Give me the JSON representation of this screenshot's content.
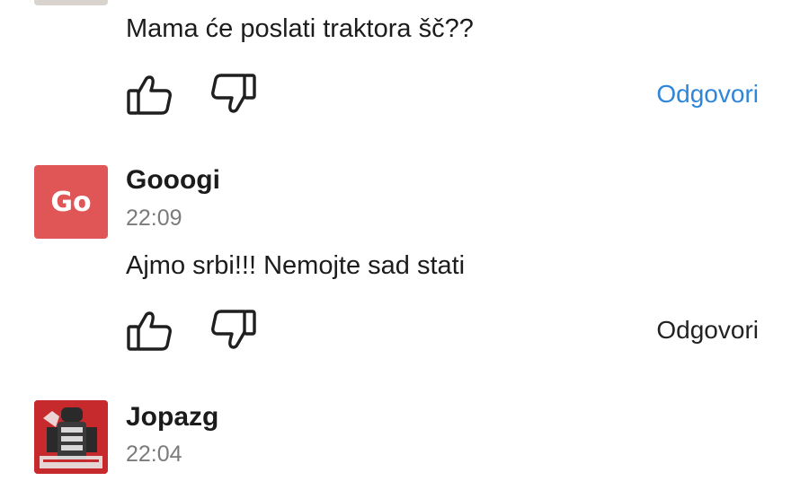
{
  "colors": {
    "accent_link": "#2f86d8",
    "reply_neutral": "#222222",
    "avatar_gooogi": "#e05555",
    "timestamp": "#7b7b7b"
  },
  "comments": [
    {
      "text": "Mama će poslati traktora šč??",
      "reply_label": "Odgovori",
      "like_icon": "thumbs-up-icon",
      "dislike_icon": "thumbs-down-icon"
    },
    {
      "avatar_initials": "Go",
      "username": "Gooogi",
      "time": "22:09",
      "text": "Ajmo srbi!!! Nemojte sad stati",
      "reply_label": "Odgovori",
      "like_icon": "thumbs-up-icon",
      "dislike_icon": "thumbs-down-icon"
    },
    {
      "username": "Jopazg",
      "time": "22:04",
      "avatar_icon": "user-photo-avatar"
    }
  ]
}
